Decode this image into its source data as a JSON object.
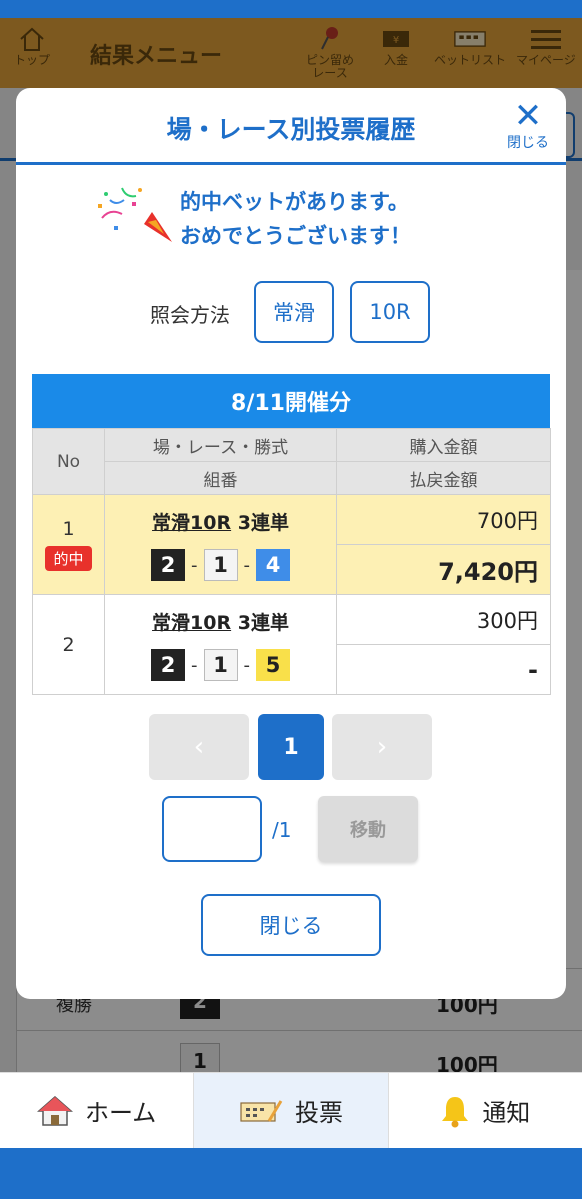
{
  "header": {
    "home_label": "トップ",
    "title": "結果メニュー",
    "pin_label_1": "ピン留め",
    "pin_label_2": "レース",
    "deposit_label": "入金",
    "betlist_label": "ベットリスト",
    "mypage_label": "マイページ"
  },
  "background": {
    "row1_label": "複勝",
    "row1_num": "2",
    "row1_amount": "100円",
    "row2_num": "1",
    "row2_amount": "100円"
  },
  "modal": {
    "title": "場・レース別投票履歴",
    "close_label": "閉じる",
    "hit_message_line1": "的中ベットがあります。",
    "hit_message_line2": "おめでとうございます！",
    "query_label": "照会方法",
    "query_venue": "常滑",
    "query_race": "10R",
    "date_header": "8/11開催分",
    "table": {
      "col_no": "No",
      "col_race": "場・レース・勝式",
      "col_combo": "組番",
      "col_purchase": "購入金額",
      "col_payout": "払戻金額",
      "rows": [
        {
          "no": "1",
          "badge": "的中",
          "race": "常滑10R",
          "bet_type": "3連単",
          "combo": [
            "2",
            "1",
            "4"
          ],
          "purchase": "700円",
          "payout": "7,420円"
        },
        {
          "no": "2",
          "race": "常滑10R",
          "bet_type": "3連単",
          "combo": [
            "2",
            "1",
            "5"
          ],
          "purchase": "300円",
          "payout": "-"
        }
      ]
    },
    "pager": {
      "prev": "‹",
      "current": "1",
      "next": "›"
    },
    "jump": {
      "input_value": "",
      "total": "/1",
      "button": "移動"
    },
    "close_button": "閉じる"
  },
  "bottom_nav": {
    "home": "ホーム",
    "vote": "投票",
    "notify": "通知"
  },
  "colors": {
    "primary": "#1e6fc9",
    "header_bg": "#e3a23a",
    "date_bar": "#1a8ae8",
    "hit_row": "#fdf0b4",
    "hit_badge": "#e8312b"
  }
}
